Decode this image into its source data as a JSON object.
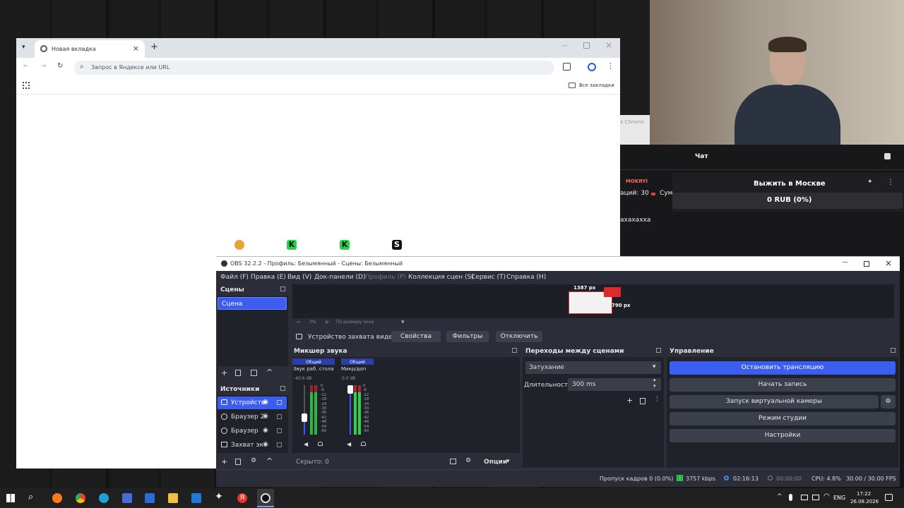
{
  "browser": {
    "tab_title": "Новая вкладка",
    "address_placeholder": "Запрос в Яндексе или URL",
    "all_bookmarks": "Все закладки",
    "new_tab_symbol": "+",
    "close_symbol": "×",
    "tiles": [
      "K",
      "K",
      "S"
    ]
  },
  "stream": {
    "chrome_hint": "e Chrome",
    "chat_title": "Чат",
    "username": "MOKRYI",
    "donation_prefix": "аций: 30",
    "donation_suffix": "Сум",
    "goal_title": "Выжить в Москве",
    "goal_amount": "0 RUB (0%)",
    "chat_message": "ахахахха"
  },
  "obs": {
    "title": "OBS 32.2.2 - Профиль: Безымянный - Сцены: Безымянный",
    "menu": [
      "Файл (F)",
      "Правка (E)",
      "Вид (V)",
      "Док-панели (D)",
      "Профиль (P)",
      "Коллекция сцен (S)",
      "Сервис (T)",
      "Справка (H)"
    ],
    "scenes_header": "Сцены",
    "scene_item": "Сцена",
    "sources_header": "Источники",
    "sources": [
      "Устройств",
      "Браузер 2",
      "Браузер",
      "Захват эк"
    ],
    "preview_width": "1387 px",
    "preview_height": "790 px",
    "zoom_label": "По размеру окна",
    "zoom_percent": "3%",
    "context_source": "Устройство захвата видео",
    "properties_btn": "Свойства",
    "filters_btn": "Фильтры",
    "disable_btn": "Отключить",
    "mixer_header": "Микшер звука",
    "mixer_channels": [
      {
        "tag": "Общий",
        "name": "Звук раб. стола",
        "db": "-40.6 dB",
        "level": 0.35
      },
      {
        "tag": "Общий",
        "name": "Микр/доп",
        "db": "0.0 dB",
        "level": 0.75
      }
    ],
    "meter_ticks": [
      "0",
      "-6",
      "-12",
      "-18",
      "-24",
      "-30",
      "-36",
      "-42",
      "-48",
      "-54",
      "-60"
    ],
    "hidden_label": "Скрыто: 0",
    "options_label": "Опции",
    "transitions_header": "Переходы между сценами",
    "transition_type": "Затухание",
    "duration_label": "Длительность",
    "duration_value": "300 ms",
    "controls_header": "Управление",
    "controls": [
      "Остановить трансляцию",
      "Начать запись",
      "Запуск виртуальной камеры",
      "Режим студии",
      "Настройки"
    ],
    "status": {
      "dropped_frames": "Пропуск кадров 0 (0.0%)",
      "bitrate": "3757 kbps",
      "stream_time": "02:16:13",
      "rec_time": "00:00:00",
      "cpu": "CPU: 4.8%",
      "fps": "30.00 / 30.00 FPS"
    }
  },
  "taskbar": {
    "lang": "ENG",
    "time": "17:22",
    "date": "26.08.2026",
    "yandex_letter": "Я"
  },
  "colors": {
    "obs_accent": "#3c5ef0",
    "obs_bg": "#2b2e38",
    "obs_panel": "#202229",
    "meter_green": "#2fd24a",
    "meter_red": "#b5222c"
  }
}
